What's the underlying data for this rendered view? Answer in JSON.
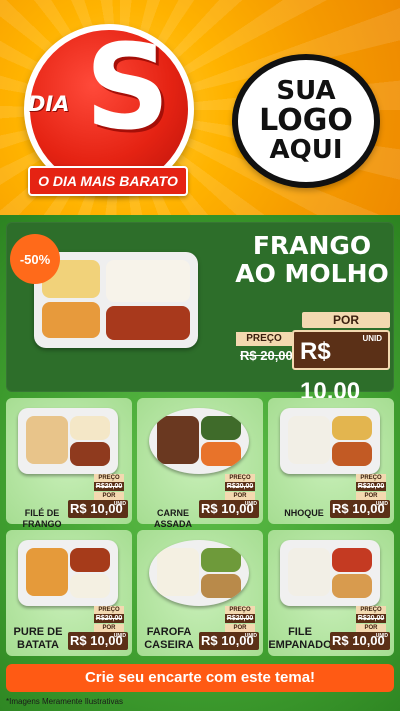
{
  "header": {
    "brand_top": "DIA",
    "brand_letter": "S",
    "ribbon": "O DIA MAIS BARATO",
    "logo_lines": [
      "SUA",
      "LOGO",
      "AQUI"
    ]
  },
  "featured": {
    "discount": "-50%",
    "title_line1": "FRANGO",
    "title_line2": "AO MOLHO",
    "preco_label": "PREÇO",
    "old_price": "R$ 20,00",
    "por_label": "POR",
    "new_price": "R$ 10,00",
    "unit": "UNID"
  },
  "items": [
    {
      "name": "FILÉ DE FRANGO",
      "preco_label": "PREÇO",
      "old": "R$20,00",
      "por_label": "POR",
      "price": "R$ 10,00",
      "unit": "UNID"
    },
    {
      "name": "CARNE ASSADA",
      "preco_label": "PREÇO",
      "old": "R$20,00",
      "por_label": "POR",
      "price": "R$ 10,00",
      "unit": "UNID"
    },
    {
      "name": "NHOQUE",
      "preco_label": "PREÇO",
      "old": "R$20,00",
      "por_label": "POR",
      "price": "R$ 10,00",
      "unit": "UNID"
    },
    {
      "name": "PURE DE BATATA",
      "preco_label": "PREÇO",
      "old": "R$20,00",
      "por_label": "POR",
      "price": "R$ 10,00",
      "unit": "UNID"
    },
    {
      "name": "FAROFA CASEIRA",
      "preco_label": "PREÇO",
      "old": "R$20,00",
      "por_label": "POR",
      "price": "R$ 10,00",
      "unit": "UNID"
    },
    {
      "name": "FILE EMPANADO",
      "preco_label": "PREÇO",
      "old": "R$20,00",
      "por_label": "POR",
      "price": "R$ 10,00",
      "unit": "UNID"
    }
  ],
  "cta": "Crie seu encarte com este tema!",
  "disclaimer": "*Imagens Meramente Ilustrativas",
  "colors": {
    "orange": "#f59a00",
    "red": "#e52313",
    "green": "#3f9e2f",
    "cta": "#ff5a14",
    "price_bg": "#5b3017"
  }
}
